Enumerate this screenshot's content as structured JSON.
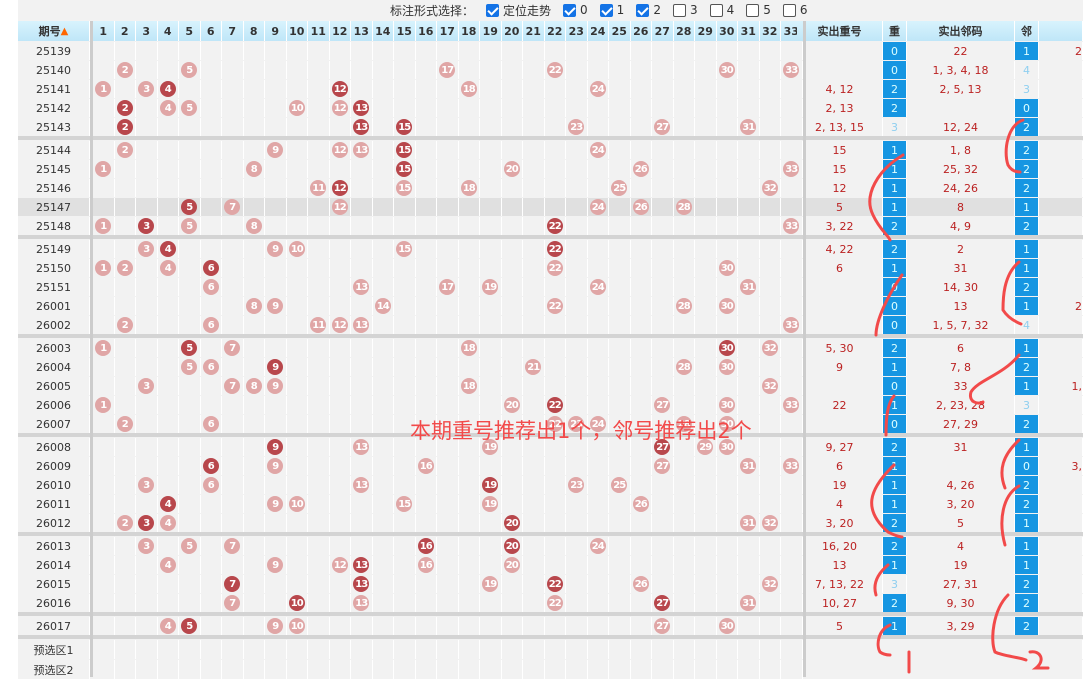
{
  "toolbar": {
    "label": "标注形式选择：",
    "options": [
      {
        "label": "定位走势",
        "checked": true
      },
      {
        "label": "0",
        "checked": true
      },
      {
        "label": "1",
        "checked": true
      },
      {
        "label": "2",
        "checked": true
      },
      {
        "label": "3",
        "checked": false
      },
      {
        "label": "4",
        "checked": false
      },
      {
        "label": "5",
        "checked": false
      },
      {
        "label": "6",
        "checked": false
      }
    ]
  },
  "headers": {
    "period": "期号",
    "repeat_nums": "实出重号",
    "repeat_count": "重",
    "adj_nums": "实出邻码",
    "adj_count": "邻"
  },
  "sort_icon": "sort-arrows-icon",
  "colors": {
    "ball_light": "#e0a6a6",
    "ball_dark": "#b8474c",
    "count_box": "#1696e2",
    "annotation": "#f24a4a"
  },
  "groups": [
    [
      {
        "p": "25139",
        "b": [],
        "r": "",
        "c": "0",
        "a": "22",
        "n": "1",
        "x": "2"
      },
      {
        "p": "25140",
        "b": [
          2,
          5,
          17,
          22,
          30,
          33
        ],
        "r": "",
        "c": "0",
        "a": "1, 3, 4, 18",
        "n": "4"
      },
      {
        "p": "25141",
        "b": [
          1,
          3,
          4,
          12,
          18,
          24
        ],
        "r": "4, 12",
        "c": "2",
        "a": "2, 5, 13",
        "n": "3"
      },
      {
        "p": "25142",
        "b": [
          2,
          4,
          5,
          10,
          12,
          13
        ],
        "r": "2, 13",
        "c": "2",
        "a": "",
        "n": "0"
      },
      {
        "p": "25143",
        "b": [
          2,
          13,
          15,
          23,
          27,
          31
        ],
        "r": "2, 13, 15",
        "c": "3",
        "a": "12, 24",
        "n": "2"
      }
    ],
    [
      {
        "p": "25144",
        "b": [
          2,
          9,
          12,
          13,
          15,
          24
        ],
        "r": "15",
        "c": "1",
        "a": "1, 8",
        "n": "2"
      },
      {
        "p": "25145",
        "b": [
          1,
          8,
          15,
          20,
          26,
          33
        ],
        "r": "15",
        "c": "1",
        "a": "25, 32",
        "n": "2"
      },
      {
        "p": "25146",
        "b": [
          11,
          12,
          15,
          18,
          25,
          32
        ],
        "r": "12",
        "c": "1",
        "a": "24, 26",
        "n": "2"
      },
      {
        "p": "25147",
        "b": [
          5,
          7,
          12,
          24,
          26,
          28
        ],
        "r": "5",
        "c": "1",
        "a": "8",
        "n": "1",
        "hl": true
      },
      {
        "p": "25148",
        "b": [
          1,
          3,
          5,
          8,
          22,
          33
        ],
        "r": "3, 22",
        "c": "2",
        "a": "4, 9",
        "n": "2"
      }
    ],
    [
      {
        "p": "25149",
        "b": [
          3,
          4,
          9,
          10,
          15,
          22
        ],
        "r": "4, 22",
        "c": "2",
        "a": "2",
        "n": "1"
      },
      {
        "p": "25150",
        "b": [
          1,
          2,
          4,
          6,
          22,
          30
        ],
        "r": "6",
        "c": "1",
        "a": "31",
        "n": "1"
      },
      {
        "p": "25151",
        "b": [
          6,
          13,
          17,
          19,
          24,
          31
        ],
        "r": "",
        "c": "0",
        "a": "14, 30",
        "n": "2"
      },
      {
        "p": "26001",
        "b": [
          8,
          9,
          14,
          22,
          28,
          30
        ],
        "r": "",
        "c": "0",
        "a": "13",
        "n": "1",
        "x": "2"
      },
      {
        "p": "26002",
        "b": [
          2,
          6,
          11,
          12,
          13,
          33
        ],
        "r": "",
        "c": "0",
        "a": "1, 5, 7, 32",
        "n": "4"
      }
    ],
    [
      {
        "p": "26003",
        "b": [
          1,
          5,
          7,
          18,
          30,
          32
        ],
        "r": "5, 30",
        "c": "2",
        "a": "6",
        "n": "1"
      },
      {
        "p": "26004",
        "b": [
          5,
          6,
          9,
          21,
          28,
          30
        ],
        "r": "9",
        "c": "1",
        "a": "7, 8",
        "n": "2"
      },
      {
        "p": "26005",
        "b": [
          3,
          7,
          8,
          9,
          18,
          32
        ],
        "r": "",
        "c": "0",
        "a": "33",
        "n": "1",
        "x": "1,"
      },
      {
        "p": "26006",
        "b": [
          1,
          20,
          22,
          27,
          30,
          33
        ],
        "r": "22",
        "c": "1",
        "a": "2, 23, 28",
        "n": "3"
      },
      {
        "p": "26007",
        "b": [
          2,
          6,
          22,
          23,
          24,
          28,
          30
        ],
        "r": "",
        "c": "0",
        "a": "27, 29",
        "n": "2"
      }
    ],
    [
      {
        "p": "26008",
        "b": [
          9,
          13,
          19,
          27,
          29,
          30
        ],
        "r": "9, 27",
        "c": "2",
        "a": "31",
        "n": "1"
      },
      {
        "p": "26009",
        "b": [
          6,
          9,
          16,
          27,
          31,
          33
        ],
        "r": "6",
        "c": "1",
        "a": "",
        "n": "0",
        "x": "3,"
      },
      {
        "p": "26010",
        "b": [
          3,
          6,
          13,
          19,
          23,
          25
        ],
        "r": "19",
        "c": "1",
        "a": "4, 26",
        "n": "2"
      },
      {
        "p": "26011",
        "b": [
          4,
          9,
          10,
          15,
          19,
          26
        ],
        "r": "4",
        "c": "1",
        "a": "3, 20",
        "n": "2"
      },
      {
        "p": "26012",
        "b": [
          2,
          3,
          4,
          20,
          31,
          32
        ],
        "r": "3, 20",
        "c": "2",
        "a": "5",
        "n": "1"
      }
    ],
    [
      {
        "p": "26013",
        "b": [
          3,
          5,
          7,
          16,
          20,
          24
        ],
        "r": "16, 20",
        "c": "2",
        "a": "4",
        "n": "1"
      },
      {
        "p": "26014",
        "b": [
          4,
          9,
          12,
          13,
          16,
          20
        ],
        "r": "13",
        "c": "1",
        "a": "19",
        "n": "1"
      },
      {
        "p": "26015",
        "b": [
          7,
          13,
          19,
          22,
          26,
          32
        ],
        "r": "7, 13, 22",
        "c": "3",
        "a": "27, 31",
        "n": "2"
      },
      {
        "p": "26016",
        "b": [
          7,
          10,
          13,
          22,
          27,
          31
        ],
        "r": "10, 27",
        "c": "2",
        "a": "9, 30",
        "n": "2"
      }
    ],
    [
      {
        "p": "26017",
        "b": [
          4,
          5,
          9,
          10,
          27,
          30
        ],
        "r": "5",
        "c": "1",
        "a": "3, 29",
        "n": "2"
      }
    ]
  ],
  "preselect": [
    "预选区1",
    "预选区2"
  ],
  "annotation": {
    "text": "本期重号推荐出1个，邻号推荐出2个",
    "handwritten": [
      "1",
      "2"
    ]
  }
}
